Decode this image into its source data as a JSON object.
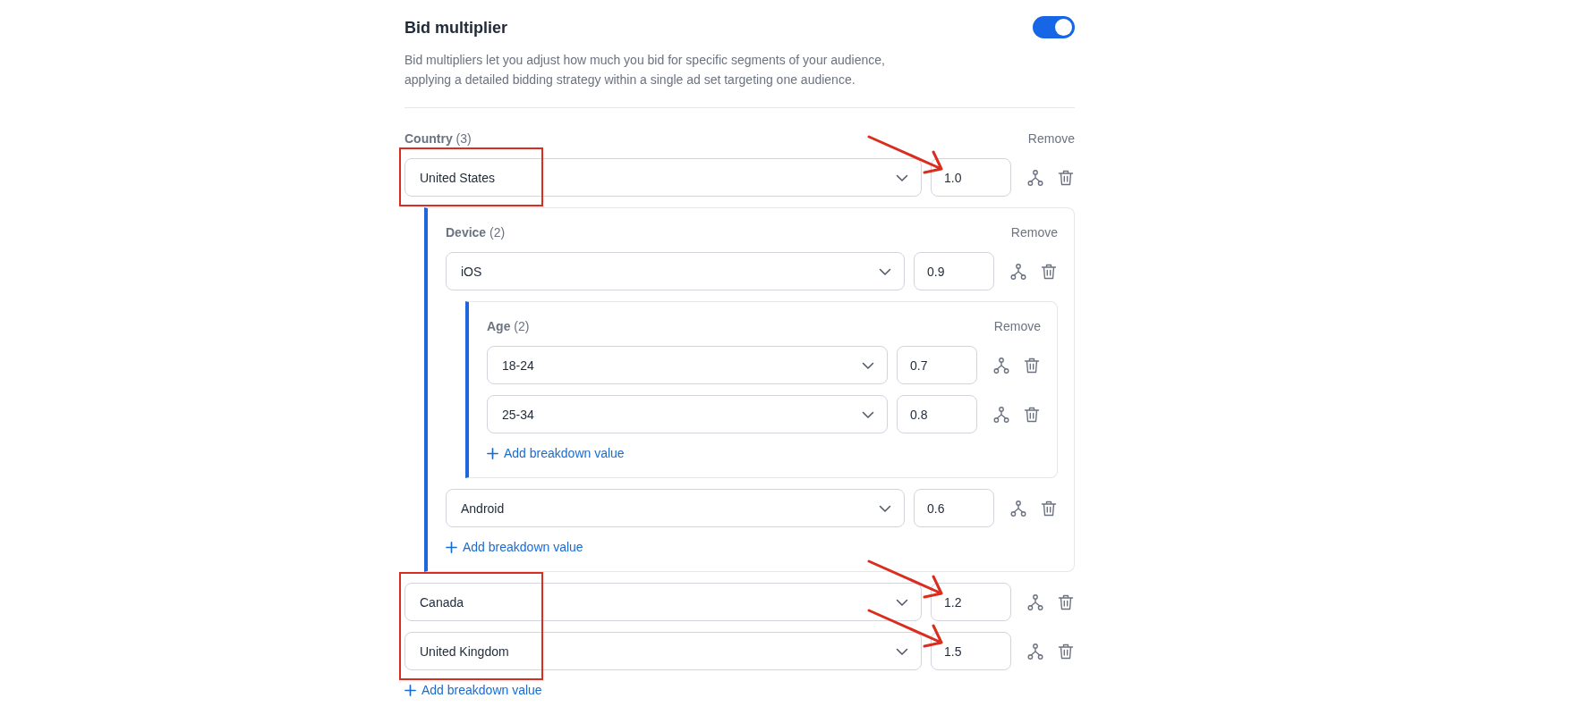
{
  "section": {
    "title": "Bid multiplier",
    "on": true,
    "description": "Bid multipliers let you adjust how much you bid for specific segments of your audience, applying a detailed bidding strategy within a single ad set targeting one audience."
  },
  "breakdown": {
    "label": "**Country** (3)",
    "remove_label": "Remove",
    "values": [
      {
        "value": "United States",
        "multiplier": "1.0",
        "outlined": true,
        "arrowed": true,
        "breakdown": {
          "label": "**Device** (2)",
          "remove_label": "Remove",
          "values": [
            {
              "value": "iOS",
              "multiplier": "0.9",
              "breakdown": {
                "label": "**Age** (2)",
                "remove_label": "Remove",
                "values": [
                  {
                    "value": "18-24",
                    "multiplier": "0.7"
                  },
                  {
                    "value": "25-34",
                    "multiplier": "0.8"
                  }
                ],
                "add_label": "Add breakdown value"
              }
            },
            {
              "value": "Android",
              "multiplier": "0.6"
            }
          ],
          "add_label": "Add breakdown value"
        }
      },
      {
        "value": "Canada",
        "multiplier": "1.2",
        "outlined": true,
        "arrowed": true
      },
      {
        "value": "United Kingdom",
        "multiplier": "1.5",
        "outlined": true,
        "arrowed": true
      }
    ],
    "add_label": "Add breakdown value"
  }
}
